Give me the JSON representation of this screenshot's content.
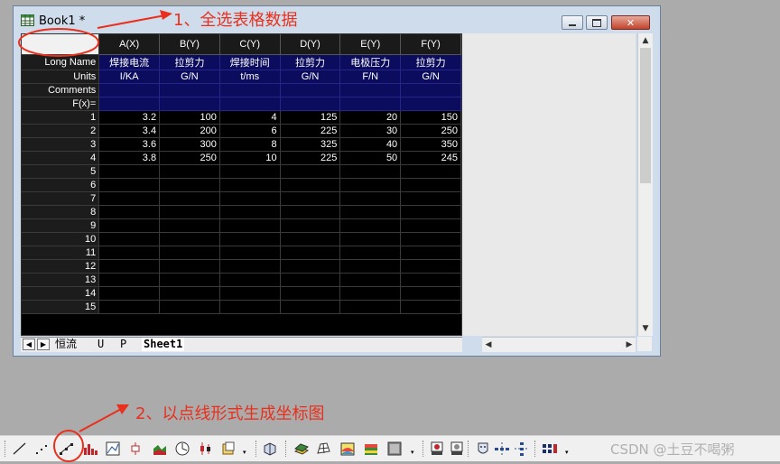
{
  "window": {
    "title": "Book1 *"
  },
  "columns": [
    "A(X)",
    "B(Y)",
    "C(Y)",
    "D(Y)",
    "E(Y)",
    "F(Y)"
  ],
  "label_rows": [
    {
      "label": "Long Name",
      "values": [
        "焊接电流",
        "拉剪力",
        "焊接时间",
        "拉剪力",
        "电极压力",
        "拉剪力"
      ]
    },
    {
      "label": "Units",
      "values": [
        "I/KA",
        "G/N",
        "t/ms",
        "G/N",
        "F/N",
        "G/N"
      ]
    },
    {
      "label": "Comments",
      "values": [
        "",
        "",
        "",
        "",
        "",
        ""
      ]
    },
    {
      "label": "F(x)=",
      "values": [
        "",
        "",
        "",
        "",
        "",
        ""
      ]
    }
  ],
  "rows": [
    {
      "n": "1",
      "cells": [
        "3.2",
        "100",
        "4",
        "125",
        "20",
        "150"
      ]
    },
    {
      "n": "2",
      "cells": [
        "3.4",
        "200",
        "6",
        "225",
        "30",
        "250"
      ]
    },
    {
      "n": "3",
      "cells": [
        "3.6",
        "300",
        "8",
        "325",
        "40",
        "350"
      ]
    },
    {
      "n": "4",
      "cells": [
        "3.8",
        "250",
        "10",
        "225",
        "50",
        "245"
      ]
    },
    {
      "n": "5",
      "cells": [
        "",
        "",
        "",
        "",
        "",
        ""
      ]
    },
    {
      "n": "6",
      "cells": [
        "",
        "",
        "",
        "",
        "",
        ""
      ]
    },
    {
      "n": "7",
      "cells": [
        "",
        "",
        "",
        "",
        "",
        ""
      ]
    },
    {
      "n": "8",
      "cells": [
        "",
        "",
        "",
        "",
        "",
        ""
      ]
    },
    {
      "n": "9",
      "cells": [
        "",
        "",
        "",
        "",
        "",
        ""
      ]
    },
    {
      "n": "10",
      "cells": [
        "",
        "",
        "",
        "",
        "",
        ""
      ]
    },
    {
      "n": "11",
      "cells": [
        "",
        "",
        "",
        "",
        "",
        ""
      ]
    },
    {
      "n": "12",
      "cells": [
        "",
        "",
        "",
        "",
        "",
        ""
      ]
    },
    {
      "n": "13",
      "cells": [
        "",
        "",
        "",
        "",
        "",
        ""
      ]
    },
    {
      "n": "14",
      "cells": [
        "",
        "",
        "",
        "",
        "",
        ""
      ]
    },
    {
      "n": "15",
      "cells": [
        "",
        "",
        "",
        "",
        "",
        ""
      ]
    }
  ],
  "sheet_tabs": [
    "恒流",
    "U",
    "P",
    "Sheet1"
  ],
  "annotations": {
    "step1": "1、全选表格数据",
    "step2": "2、以点线形式生成坐标图",
    "color": "#e8301d"
  },
  "toolbar_icons": [
    "line-plot-icon",
    "scatter-plot-icon",
    "line-symbol-plot-icon",
    "column-plot-icon",
    "picture-plot-icon",
    "box-plot-icon",
    "area-plot-icon",
    "polar-plot-icon",
    "high-low-plot-icon",
    "template-plot-icon",
    "3d-plot-icon",
    "3d-surface-icon",
    "3d-wire-icon",
    "contour-icon",
    "heatmap-icon",
    "image-icon",
    "smiley-icon",
    "smiley-icon-2",
    "mask-icon",
    "arrange-horizontal-icon",
    "arrange-vertical-icon",
    "layout-icon"
  ],
  "watermark": "CSDN @土豆不喝粥"
}
